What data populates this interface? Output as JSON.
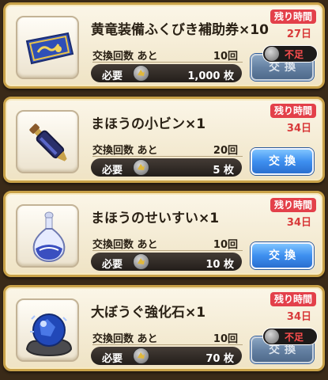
{
  "labels": {
    "exchange_count": "交換回数 あと",
    "cost": "必要",
    "remaining_time": "残り時間",
    "exchange_button": "交換",
    "shortage": "不足"
  },
  "items": [
    {
      "name": "黄竜装備ふくびき補助券×10",
      "icon": "ticket-icon",
      "remaining": "10回",
      "cost": "1,000 枚",
      "time_left": "27日",
      "state": "disabled-shortage"
    },
    {
      "name": "まほうの小ビン×1",
      "icon": "small-bottle-icon",
      "remaining": "20回",
      "cost": "5 枚",
      "time_left": "34日",
      "state": "enabled"
    },
    {
      "name": "まほうのせいすい×1",
      "icon": "holy-water-flask-icon",
      "remaining": "10回",
      "cost": "10 枚",
      "time_left": "34日",
      "state": "enabled"
    },
    {
      "name": "大ぼうぐ強化石×1",
      "icon": "blue-orb-stone-icon",
      "remaining": "10回",
      "cost": "70 枚",
      "time_left": "34日",
      "state": "disabled-shortage"
    }
  ],
  "colors": {
    "button": "#3e8fef",
    "time_badge": "#e3404a",
    "shortage_text": "#ff4e4e",
    "card_border": "#c9a249"
  }
}
